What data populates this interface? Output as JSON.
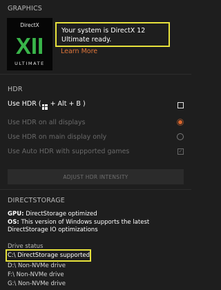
{
  "graphics": {
    "section_title": "GRAPHICS",
    "logo": {
      "top_text": "DirectX",
      "big_text": "XII",
      "bottom_text": "ULTIMATE"
    },
    "system_message": "Your system is DirectX 12 Ultimate ready.",
    "learn_more": "Learn More"
  },
  "hdr": {
    "section_title": "HDR",
    "use_hdr_label": "Use HDR (",
    "use_hdr_shortcut": " + Alt + B )",
    "use_hdr_checked": false,
    "options": [
      {
        "label": "Use HDR on all displays",
        "type": "radio",
        "selected": true
      },
      {
        "label": "Use HDR on main display only",
        "type": "radio",
        "selected": false
      },
      {
        "label": "Use Auto HDR with supported games",
        "type": "checkbox",
        "checked": true
      }
    ],
    "adjust_button": "ADJUST HDR INTENSITY"
  },
  "directstorage": {
    "section_title": "DIRECTSTORAGE",
    "gpu_label": "GPU:",
    "gpu_value": " DirectStorage optimized",
    "os_label": "OS:",
    "os_value_line1": " This version of Windows supports the latest",
    "os_value_line2": "DirectStorage IO optimizations",
    "drive_status_label": "Drive status",
    "drives": [
      {
        "drive": "C:\\",
        "status": "DirectStorage supported"
      },
      {
        "drive": "D:\\",
        "status": "Non-NVMe drive"
      },
      {
        "drive": "F:\\",
        "status": "Non-NVMe drive"
      },
      {
        "drive": "G:\\",
        "status": "Non-NVMe drive"
      }
    ]
  },
  "colors": {
    "background": "#1e1e1e",
    "highlight": "#e8e23c",
    "accent_orange": "#e0763a",
    "logo_green": "#39b54a"
  }
}
